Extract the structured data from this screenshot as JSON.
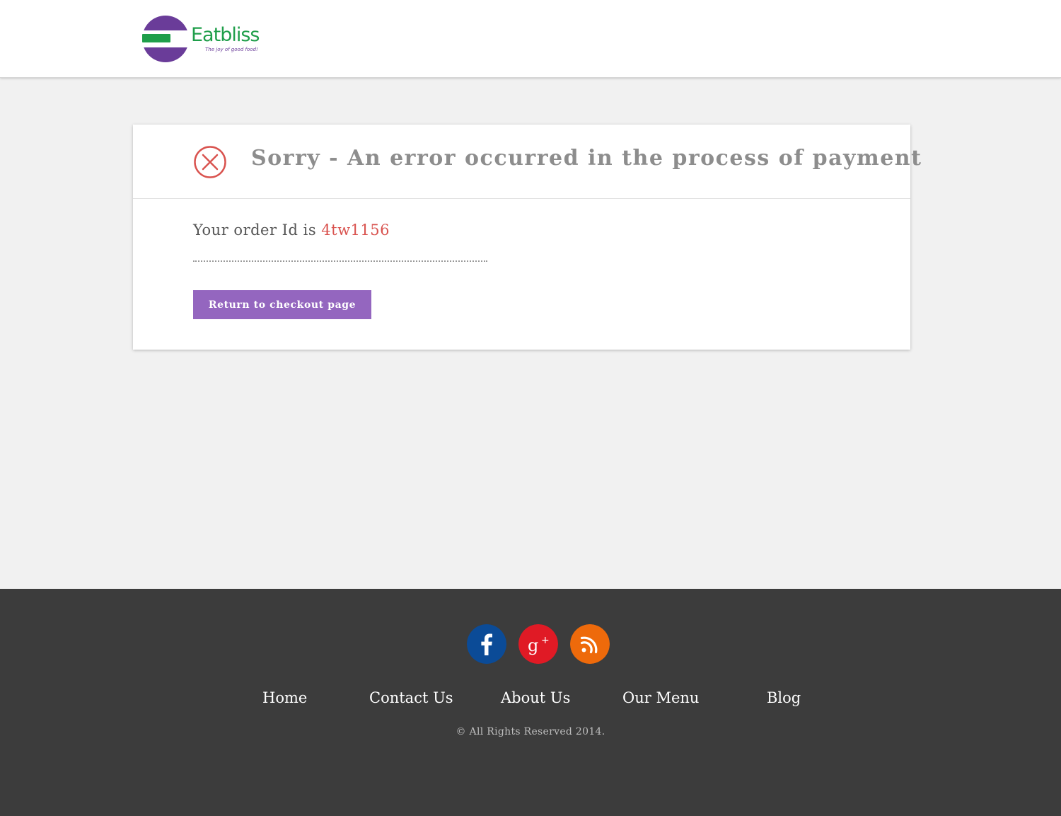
{
  "header": {
    "logo": {
      "name": "Eatbliss",
      "tagline": "The joy of good food!",
      "colors": {
        "purple": "#6a3c99",
        "green": "#1f9e4a"
      }
    }
  },
  "error_card": {
    "title": "Sorry - An error occurred in the process of payment",
    "order_prefix": "Your order Id is",
    "order_id": "4tw1156",
    "button_label": "Return to checkout page",
    "icon": "circle-x-icon",
    "colors": {
      "error": "#d9534f",
      "button": "#9466bf",
      "title": "#8d8d8d"
    }
  },
  "footer": {
    "social": [
      {
        "name": "facebook",
        "icon": "facebook-icon",
        "color": "#0b4b97"
      },
      {
        "name": "google-plus",
        "icon": "google-plus-icon",
        "color": "#e01a25"
      },
      {
        "name": "rss",
        "icon": "rss-icon",
        "color": "#ee6a0b"
      }
    ],
    "nav": [
      "Home",
      "Contact Us",
      "About Us",
      "Our Menu",
      "Blog"
    ],
    "copyright": "© All Rights Reserved 2014.",
    "background": "#3c3c3c"
  }
}
